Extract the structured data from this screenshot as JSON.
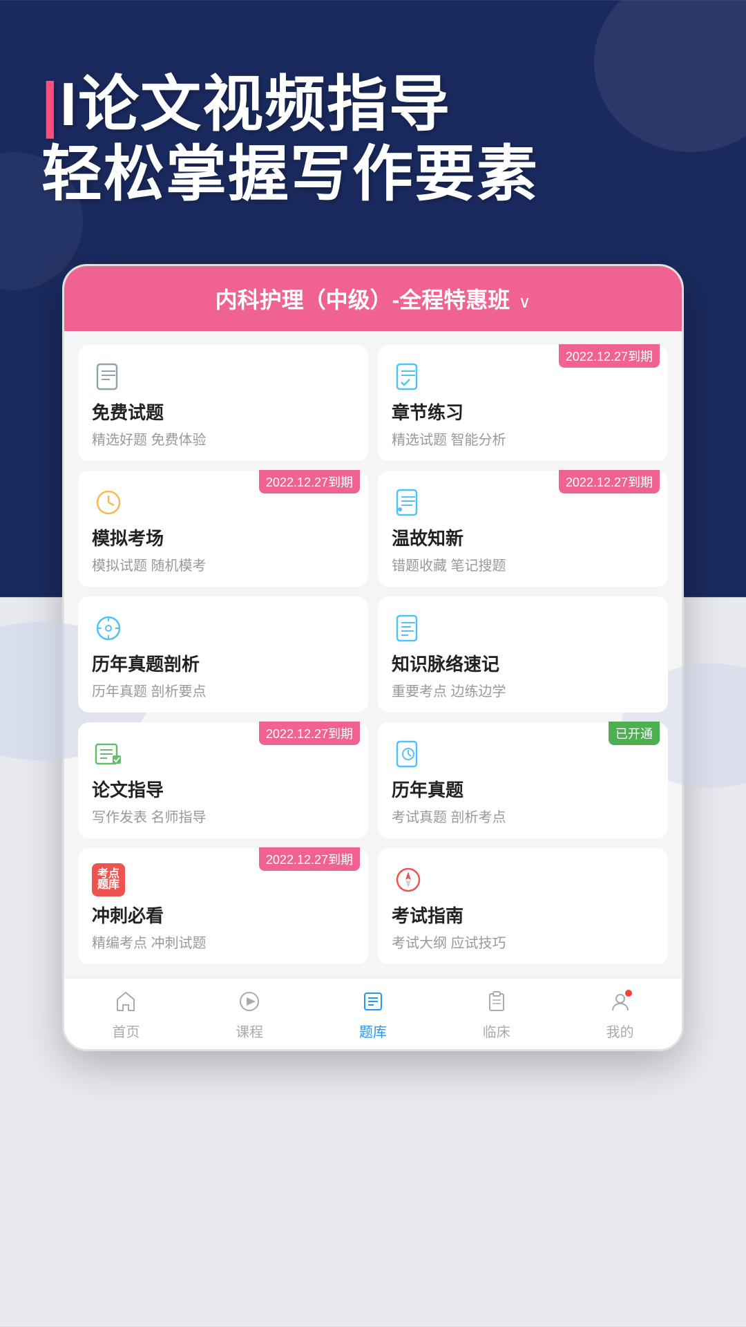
{
  "hero": {
    "line1": "I论文视频指导",
    "line2": "轻松掌握写作要素"
  },
  "app": {
    "header": {
      "title": "内科护理（中级）-全程特惠班",
      "chevron": "∨"
    },
    "cards": [
      {
        "id": "free-exam",
        "title": "免费试题",
        "desc": "精选好题 免费体验",
        "badge": null,
        "icon": "doc"
      },
      {
        "id": "chapter-practice",
        "title": "章节练习",
        "desc": "精选试题 智能分析",
        "badge": "2022.12.27到期",
        "badgeType": "normal",
        "icon": "doc-check"
      },
      {
        "id": "mock-exam",
        "title": "模拟考场",
        "desc": "模拟试题 随机模考",
        "badge": "2022.12.27到期",
        "badgeType": "normal",
        "icon": "clock"
      },
      {
        "id": "review",
        "title": "温故知新",
        "desc": "错题收藏 笔记搜题",
        "badge": "2022.12.27到期",
        "badgeType": "normal",
        "icon": "note"
      },
      {
        "id": "past-analysis",
        "title": "历年真题剖析",
        "desc": "历年真题 剖析要点",
        "badge": null,
        "icon": "history"
      },
      {
        "id": "knowledge",
        "title": "知识脉络速记",
        "desc": "重要考点 边练边学",
        "badge": null,
        "icon": "knowledge"
      },
      {
        "id": "essay",
        "title": "论文指导",
        "desc": "写作发表 名师指导",
        "badge": "2022.12.27到期",
        "badgeType": "normal",
        "icon": "essay"
      },
      {
        "id": "past-exam",
        "title": "历年真题",
        "desc": "考试真题 剖析考点",
        "badge": "已开通",
        "badgeType": "activated",
        "icon": "exam-history"
      },
      {
        "id": "sprint",
        "title": "冲刺必看",
        "desc": "精编考点 冲刺试题",
        "badge": "2022.12.27到期",
        "badgeType": "normal",
        "icon": "sprint"
      },
      {
        "id": "guide",
        "title": "考试指南",
        "desc": "考试大纲 应试技巧",
        "badge": null,
        "icon": "compass"
      }
    ],
    "nav": [
      {
        "id": "home",
        "label": "首页",
        "active": false,
        "icon": "home"
      },
      {
        "id": "course",
        "label": "课程",
        "active": false,
        "icon": "play"
      },
      {
        "id": "question",
        "label": "题库",
        "active": true,
        "icon": "list"
      },
      {
        "id": "clinical",
        "label": "临床",
        "active": false,
        "icon": "clipboard"
      },
      {
        "id": "mine",
        "label": "我的",
        "active": false,
        "icon": "user",
        "dot": true
      }
    ]
  }
}
